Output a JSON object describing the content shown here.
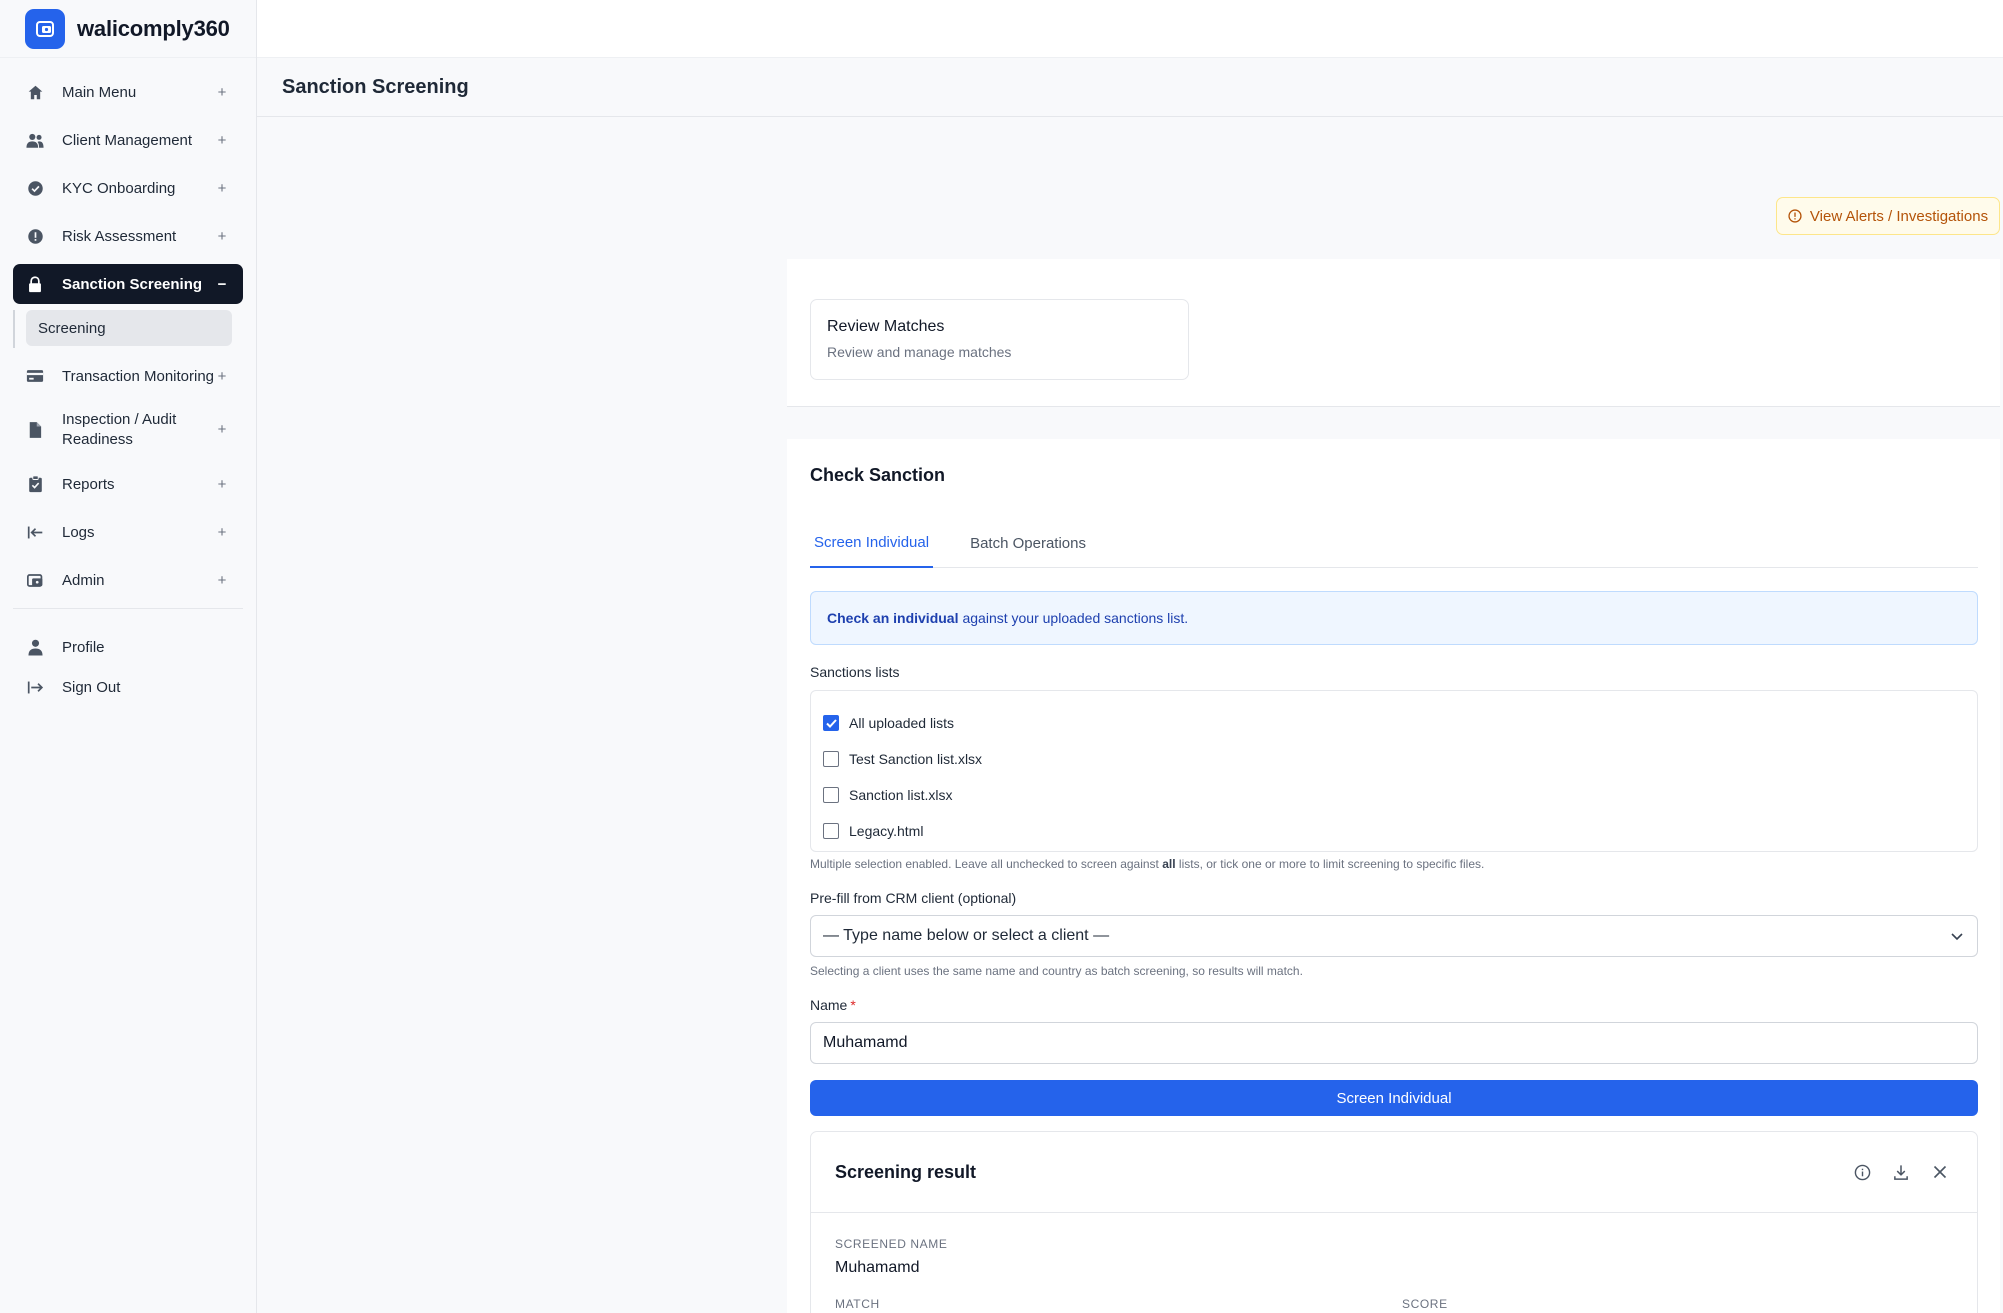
{
  "app": {
    "name": "walicomply360",
    "brand_color": "#2563eb"
  },
  "sidebar": {
    "items": [
      {
        "label": "Main Menu",
        "icon": "home-icon",
        "toggle": "+"
      },
      {
        "label": "Client Management",
        "icon": "users-icon",
        "toggle": "+"
      },
      {
        "label": "KYC Onboarding",
        "icon": "check-circle-icon",
        "toggle": "+"
      },
      {
        "label": "Risk Assessment",
        "icon": "alert-circle-icon",
        "toggle": "+"
      },
      {
        "label": "Sanction Screening",
        "icon": "lock-icon",
        "toggle": "−",
        "active": true
      },
      {
        "label": "Transaction Monitoring",
        "icon": "credit-card-icon",
        "toggle": "+"
      },
      {
        "label": "Inspection / Audit Readiness",
        "icon": "document-icon",
        "toggle": "+"
      },
      {
        "label": "Reports",
        "icon": "clipboard-check-icon",
        "toggle": "+"
      },
      {
        "label": "Logs",
        "icon": "arrow-left-bar-icon",
        "toggle": "+"
      },
      {
        "label": "Admin",
        "icon": "admin-icon",
        "toggle": "+"
      }
    ],
    "subitems": {
      "screening": "Screening"
    },
    "footer": {
      "profile": "Profile",
      "sign_out": "Sign Out"
    }
  },
  "header": {
    "page_title": "Sanction Screening"
  },
  "alerts_button": {
    "label": "View Alerts / Investigations",
    "icon": "info-icon",
    "color": "#b45309"
  },
  "review_card": {
    "title": "Review Matches",
    "subtitle": "Review and manage matches"
  },
  "check": {
    "title": "Check Sanction",
    "tabs": [
      {
        "label": "Screen Individual",
        "active": true
      },
      {
        "label": "Batch Operations",
        "active": false
      }
    ],
    "info": {
      "bold": "Check an individual",
      "rest": "against your uploaded sanctions list."
    },
    "sanctions_label": "Sanctions lists",
    "lists": [
      {
        "label": "All uploaded lists",
        "checked": true
      },
      {
        "label": "Test Sanction list.xlsx",
        "checked": false
      },
      {
        "label": "Sanction list.xlsx",
        "checked": false
      },
      {
        "label": "Legacy.html",
        "checked": false
      }
    ],
    "lists_help": {
      "part1": "Multiple selection enabled. Leave all unchecked to screen against",
      "bold": "all",
      "part2": "lists, or tick one or more to limit screening to specific files."
    },
    "prefill_label": "Pre-fill from CRM client (optional)",
    "prefill_value": "— Type name below or select a client —",
    "prefill_help": "Selecting a client uses the same name and country as batch screening, so results will match.",
    "name_label": "Name",
    "name_required": "*",
    "name_value": "Muhamamd",
    "submit_label": "Screen Individual"
  },
  "result": {
    "title": "Screening result",
    "screened_name_label": "SCREENED NAME",
    "screened_name_value": "Muhamamd",
    "match_label": "MATCH",
    "score_label": "SCORE"
  }
}
